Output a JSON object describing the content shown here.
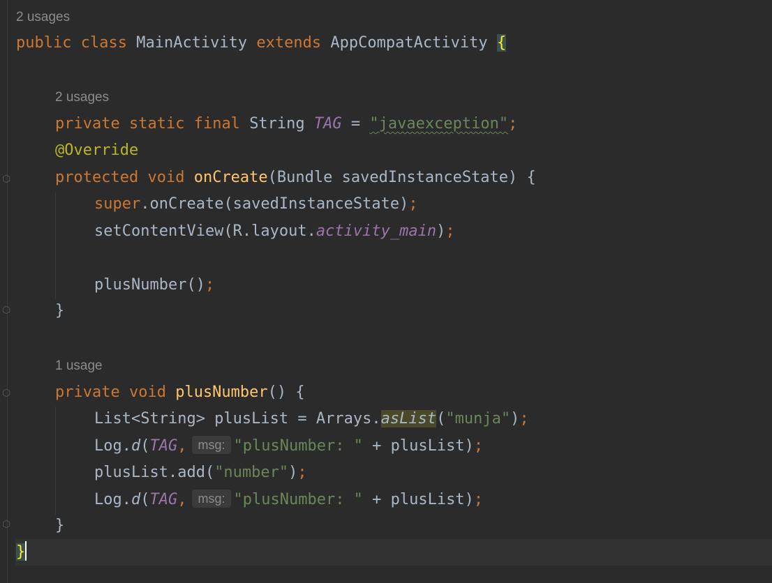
{
  "editor": {
    "hint_class_usages": "2 usages",
    "hint_tag_usages": "2 usages",
    "hint_plus_usage": "1 usage",
    "kw_public": "public",
    "kw_class": "class",
    "class_name": "MainActivity",
    "kw_extends": "extends",
    "super_class": "AppCompatActivity",
    "brace_open": "{",
    "kw_private": "private",
    "kw_static": "static",
    "kw_final": "final",
    "type_string": "String",
    "const_tag": "TAG",
    "eq": "=",
    "tag_value": "\"javaexception\"",
    "semicolon": ";",
    "annotation": "@Override",
    "kw_protected": "protected",
    "kw_void": "void",
    "method_oncreate": "onCreate",
    "oncreate_params": "(Bundle savedInstanceState) {",
    "kw_super": "super",
    "super_call": ".onCreate(savedInstanceState)",
    "set_content": "setContentView(R.layout.",
    "const_layout": "activity_main",
    "close_paren": ")",
    "plus_call": "plusNumber()",
    "brace_close": "}",
    "method_plus": "plusNumber",
    "plus_params": "() {",
    "list_decl": "List<String> plusList = Arrays.",
    "aslist": "asList",
    "open_paren": "(",
    "str_munja": "\"munja\"",
    "log": "Log.",
    "log_d": "d",
    "comma": ",",
    "msg_hint": "msg:",
    "str_plusnumber": "\"plusNumber: \"",
    "plus_concat": " + plusList)",
    "list_add": "plusList.add(",
    "str_number": "\"number\"",
    "final_brace": "}"
  },
  "colors": {
    "background": "#2b2b2b",
    "keyword": "#cc7832",
    "method": "#ffc66d",
    "string": "#6a8759",
    "constant": "#9876aa",
    "annotation": "#bbb529",
    "text": "#a9b7c6"
  }
}
